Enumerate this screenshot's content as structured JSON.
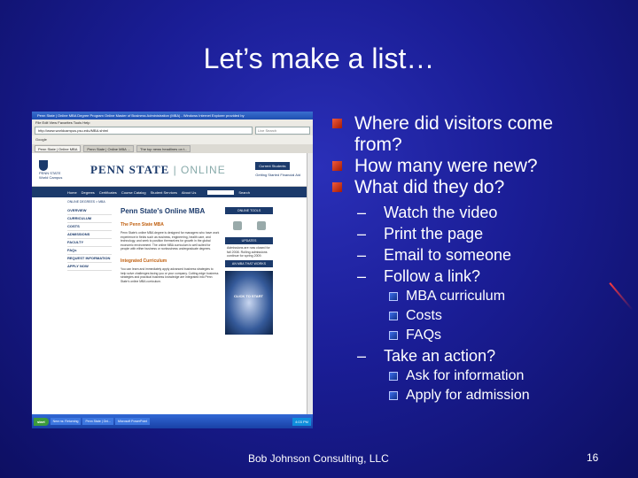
{
  "slide": {
    "title": "Let’s make a list…",
    "footer": "Bob Johnson Consulting, LLC",
    "page_number": "16"
  },
  "bullets": [
    {
      "text": "Where did visitors come from?"
    },
    {
      "text": "How many were new?"
    },
    {
      "text": "What did they do?"
    }
  ],
  "sub_bullets": [
    "Watch the video",
    "Print the page",
    "Email to someone",
    "Follow a link?"
  ],
  "link_items": [
    "MBA curriculum",
    "Costs",
    "FAQs"
  ],
  "action_bullet": "Take an action?",
  "action_items": [
    "Ask for information",
    "Apply for admission"
  ],
  "screenshot": {
    "window_title": "Penn State | Online MBA Degree Program Online Master of Business Administration (MBA) - Windows Internet Explorer provided by",
    "menu": "File  Edit  View  Favorites  Tools  Help",
    "url": "http://www.worldcampus.psu.edu/MBA.shtml",
    "search": "Live Search",
    "google_bar": "Google",
    "tabs": [
      "Penn State | Online MBA",
      "Penn State | Online MBA ...",
      "The top news headlines on t..."
    ],
    "header": {
      "logo_line1": "PENN STATE",
      "logo_line2": "World Campus",
      "brand": "PENN STATE",
      "brand2": "| ONLINE",
      "current": "Current Students",
      "getting": "Getting Started  Financial Aid"
    },
    "nav": [
      "Home",
      "Degrees",
      "Certificates",
      "Course Catalog",
      "Student Services",
      "About Us"
    ],
    "nav_search": "Search",
    "breadcrumb": "ONLINE DEGREES > MBA",
    "sidebar": [
      "OVERVIEW",
      "CURRICULUM",
      "COSTS",
      "ADMISSIONS",
      "FACULTY",
      "FAQs",
      "REQUEST INFORMATION",
      "APPLY NOW"
    ],
    "heading": "Penn State's Online MBA",
    "subheading": "The Penn State MBA",
    "para1": "Penn State's online MBA degree is designed for managers who have work experience in fields such as business, engineering, health care, and technology, and seek to position themselves for growth in the global economic environment. The online MBA curriculum is well suited for people with either business or nonbusiness undergraduate degrees.",
    "subheading2": "Integrated Curriculum",
    "para2": "You can learn and immediately apply advanced business strategies to help solve challenges facing you or your company. Cutting-edge business strategies and practical business knowledge are integrated into Penn State's online MBA curriculum.",
    "tools": "ONLINE TOOLS",
    "updates": "UPDATES",
    "updates_text": "Admissions are now closed for fall 2008. Rolling admissions continue for spring 2009.",
    "video_label": "AN MBA THAT WORKS",
    "video_cta": "CLICK TO START",
    "taskbar": {
      "start": "start",
      "tasks": [
        "New ns: Returning",
        "Penn State | Onl...",
        "Microsoft PowerPoint"
      ],
      "clock": "4:03 PM"
    }
  }
}
